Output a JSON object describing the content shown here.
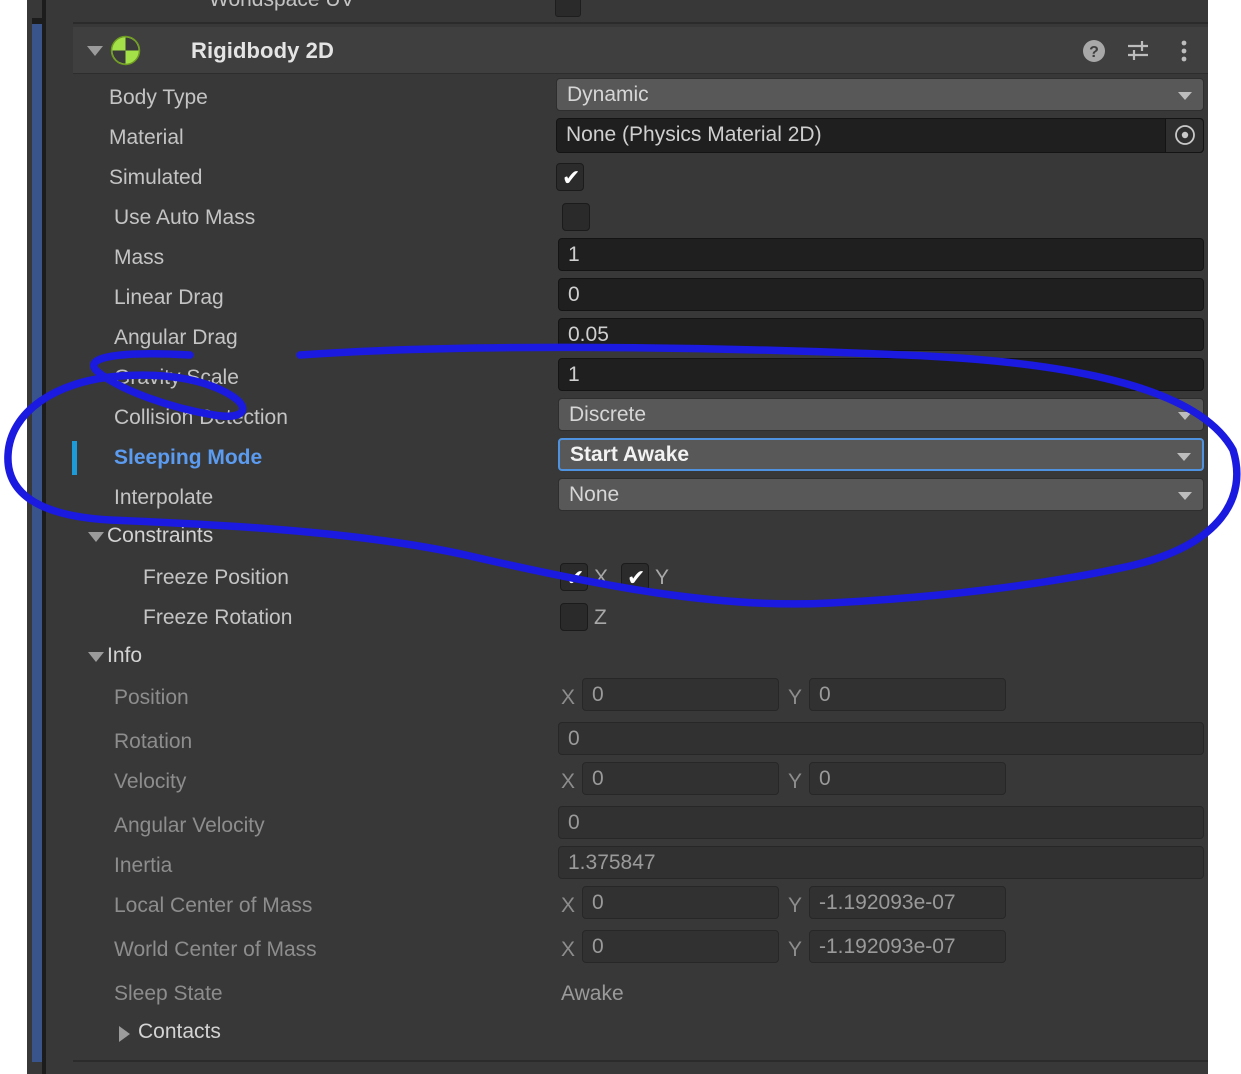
{
  "panel": {
    "partial_row_above": {
      "label": "Worldspace UV",
      "checked": false
    },
    "component": {
      "title": "Rigidbody 2D",
      "icon": "rigidbody2d-icon",
      "expanded": true,
      "header_icons": [
        "help-icon",
        "preset-icon",
        "more-menu-icon"
      ]
    }
  },
  "fields": [
    {
      "label": "Body Type",
      "type": "popup",
      "value": "Dynamic"
    },
    {
      "label": "Material",
      "type": "object",
      "value": "None (Physics Material 2D)"
    },
    {
      "label": "Simulated",
      "type": "checkbox",
      "value": "checked"
    },
    {
      "label": "Use Auto Mass",
      "type": "checkbox",
      "value": "unchecked",
      "indent": true
    },
    {
      "label": "Mass",
      "type": "number",
      "value": "1",
      "indent": true
    },
    {
      "label": "Linear Drag",
      "type": "number",
      "value": "0",
      "indent": true
    },
    {
      "label": "Angular Drag",
      "type": "number",
      "value": "0.05",
      "indent": true
    },
    {
      "label": "Gravity Scale",
      "type": "number",
      "value": "1",
      "indent": true
    },
    {
      "label": "Collision Detection",
      "type": "popup",
      "value": "Discrete",
      "indent": true
    },
    {
      "label": "Sleeping Mode",
      "type": "popup",
      "value": "Start Awake",
      "indent": true,
      "override": true,
      "focused": true
    },
    {
      "label": "Interpolate",
      "type": "popup",
      "value": "None",
      "indent": true
    }
  ],
  "constraints": {
    "section_label": "Constraints",
    "expanded": true,
    "freeze_position": {
      "label": "Freeze Position",
      "x_label": "X",
      "x_checked": true,
      "y_label": "Y",
      "y_checked": true
    },
    "freeze_rotation": {
      "label": "Freeze Rotation",
      "z_label": "Z",
      "z_checked": false
    }
  },
  "info": {
    "section_label": "Info",
    "expanded": true,
    "rows": [
      {
        "label": "Position",
        "type": "vec2",
        "x_label": "X",
        "x": "0",
        "y_label": "Y",
        "y": "0"
      },
      {
        "label": "Rotation",
        "type": "wide",
        "value": "0"
      },
      {
        "label": "Velocity",
        "type": "vec2",
        "x_label": "X",
        "x": "0",
        "y_label": "Y",
        "y": "0"
      },
      {
        "label": "Angular Velocity",
        "type": "wide",
        "value": "0"
      },
      {
        "label": "Inertia",
        "type": "wide",
        "value": "1.375847"
      },
      {
        "label": "Local Center of Mass",
        "type": "vec2",
        "x_label": "X",
        "x": "0",
        "y_label": "Y",
        "y": "-1.192093e-07"
      },
      {
        "label": "World Center of Mass",
        "type": "vec2",
        "x_label": "X",
        "x": "0",
        "y_label": "Y",
        "y": "-1.192093e-07"
      },
      {
        "label": "Sleep State",
        "type": "plain",
        "value": "Awake"
      }
    ],
    "contacts": {
      "label": "Contacts",
      "expanded": false
    }
  },
  "annotation": {
    "shape": "hand-drawn-ellipse",
    "color": "#1a1ae0",
    "encircles": "Sleeping Mode row"
  },
  "colors": {
    "panel_bg": "#383838",
    "header_bg": "#3f3f3f",
    "override_blue": "#5b9bf0",
    "focus_blue": "#4f93e0",
    "prefab_bar": "#39548a",
    "component_icon_green": "#a4e048",
    "annotation": "#1a1ae0"
  }
}
